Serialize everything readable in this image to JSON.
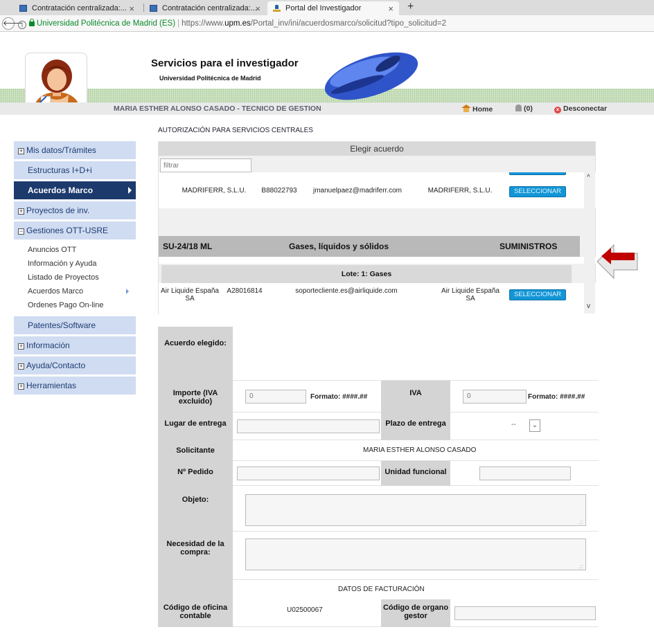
{
  "browser": {
    "tabs": [
      {
        "title": "Contratación centralizada:..."
      },
      {
        "title": "Contratación centralizada:..."
      },
      {
        "title": "Portal del Investigador"
      }
    ],
    "close_glyph": "×",
    "new_tab_glyph": "+",
    "address": {
      "back_glyph": "🡐",
      "site_identity": "Universidad Politécnica de Madrid (ES)",
      "url_prefix": "https://www.",
      "url_host": "upm.es",
      "url_path": "/Portal_inv/ini/acuerdosmarco/solicitud?tipo_solicitud=2"
    }
  },
  "site": {
    "title": "Servicios para el investigador",
    "subtitle": "Universidad Politécnica de Madrid"
  },
  "userbar": {
    "user": "MARIA ESTHER ALONSO CASADO - TECNICO DE GESTION",
    "home": "Home",
    "notifications": "(0)",
    "logout": "Desconectar"
  },
  "sidebar": {
    "items": [
      {
        "label": "Mis datos/Trámites"
      },
      {
        "label": "Estructuras I+D+i"
      },
      {
        "label": "Acuerdos Marco"
      },
      {
        "label": "Proyectos de inv."
      },
      {
        "label": "Gestiones OTT-USRE"
      },
      {
        "label": "Patentes/Software"
      },
      {
        "label": "Información"
      },
      {
        "label": "Ayuda/Contacto"
      },
      {
        "label": "Herramientas"
      }
    ],
    "submenu": [
      {
        "label": "Anuncios OTT"
      },
      {
        "label": "Información y Ayuda"
      },
      {
        "label": "Listado de Proyectos"
      },
      {
        "label": "Acuerdos Marco"
      },
      {
        "label": "Ordenes Pago On-line"
      }
    ]
  },
  "main": {
    "section_title": "AUTORIZACIÓN PARA SERVICIOS CENTRALES",
    "elegir": {
      "header": "Elegir acuerdo",
      "filter_placeholder": "filtrar",
      "select_label": "SELECCIONAR",
      "supplier1": {
        "name": "MADRIFERR, S.L.U.",
        "cif": "B88022793",
        "email": "jmanuelpaez@madriferr.com",
        "company": "MADRIFERR, S.L.U."
      },
      "contract": {
        "code": "SU-24/18 ML",
        "description": "Gases, líquidos y sólidos",
        "type": "SUMINISTROS"
      },
      "lote": "Lote: 1: Gases",
      "supplier2": {
        "name": "Air Liquide España SA",
        "cif": "A28016814",
        "email": "soportecliente.es@airliquide.com",
        "company": "Air Liquide España SA"
      }
    },
    "form": {
      "acuerdo_label": "Acuerdo elegido:",
      "importe_label": "Importe (IVA excluido)",
      "importe_value": "0",
      "formato": "Formato: ####.##",
      "iva_label": "IVA",
      "iva_value": "0",
      "lugar_label": "Lugar de entrega",
      "plazo_label": "Plazo de entrega",
      "plazo_value": "--",
      "solicitante_label": "Solicitante",
      "solicitante_value": "MARIA ESTHER ALONSO CASADO",
      "pedido_label": "Nº Pedido",
      "unidad_label": "Unidad funcional",
      "objeto_label": "Objeto:",
      "necesidad_label": "Necesidad de la compra:",
      "facturacion_title": "DATOS DE FACTURACIÓN",
      "oficina_label": "Código de oficina contable",
      "oficina_value": "U02500067",
      "organo_label": "Código de organo gestor"
    }
  },
  "colors": {
    "sidebar_bg": "#cfdcf1",
    "sidebar_active": "#1d3a6d",
    "select_button": "#1296d6",
    "arrow": "#c00000"
  }
}
